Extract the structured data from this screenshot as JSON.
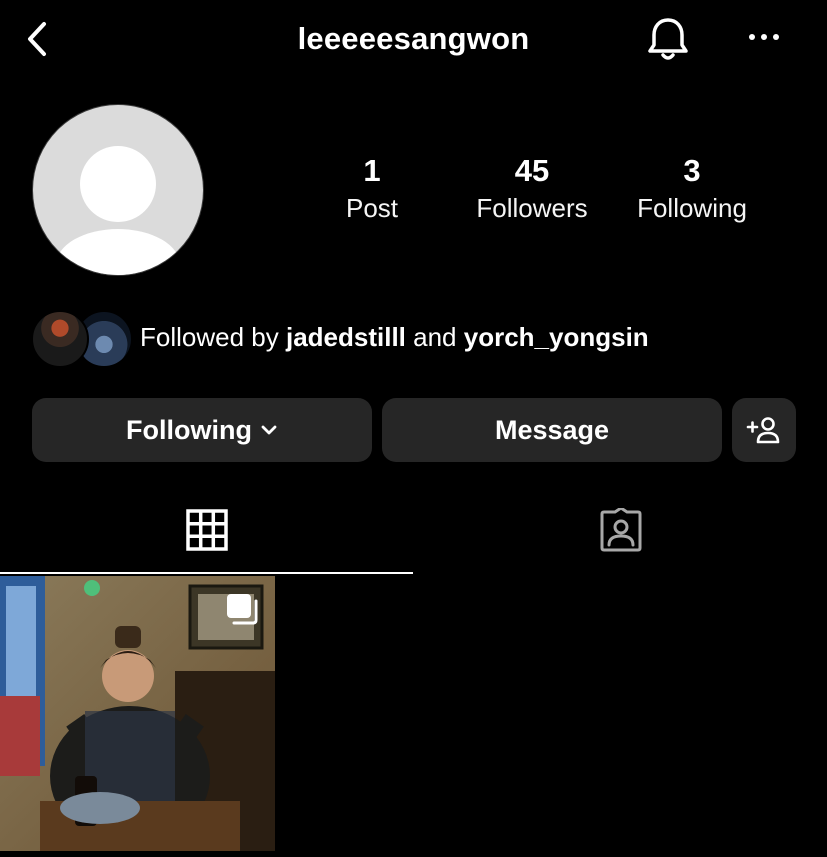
{
  "header": {
    "username": "leeeeesangwon",
    "back_icon": "chevron-left-icon",
    "bell_icon": "bell-icon",
    "more_icon": "more-horizontal-icon"
  },
  "profile": {
    "avatar": "default-avatar",
    "stats": {
      "posts": {
        "value": "1",
        "label": "Post"
      },
      "followers": {
        "value": "45",
        "label": "Followers"
      },
      "following": {
        "value": "3",
        "label": "Following"
      }
    }
  },
  "followed_by": {
    "prefix": "Followed by",
    "user1": "jadedstilll",
    "joiner": "and",
    "user2": "yorch_yongsin"
  },
  "actions": {
    "following_label": "Following",
    "message_label": "Message",
    "suggest_icon": "add-person-icon"
  },
  "tabs": [
    {
      "name": "posts-grid",
      "icon": "grid-icon",
      "active": true
    },
    {
      "name": "tagged",
      "icon": "tagged-person-icon",
      "active": false
    }
  ],
  "posts": [
    {
      "type": "carousel",
      "icon": "multiple-posts-icon"
    }
  ],
  "colors": {
    "background": "#000000",
    "button_bg": "#262626",
    "text": "#ffffff",
    "avatar_bg": "#dbdbdb"
  }
}
